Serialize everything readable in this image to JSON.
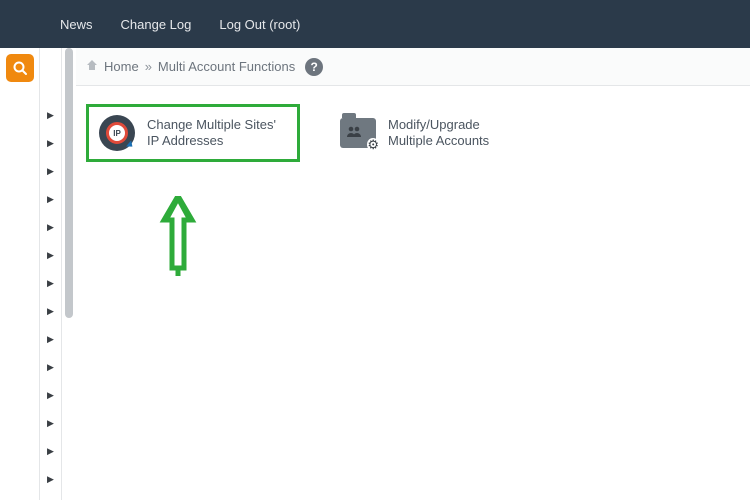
{
  "topnav": {
    "news": "News",
    "changelog": "Change Log",
    "logout": "Log Out (root)"
  },
  "breadcrumb": {
    "home": "Home",
    "sep": "»",
    "current": "Multi Account Functions"
  },
  "items": {
    "change_ip": "Change Multiple Sites' IP Addresses",
    "ip_badge": "IP",
    "modify_accounts": "Modify/Upgrade Multiple Accounts"
  }
}
